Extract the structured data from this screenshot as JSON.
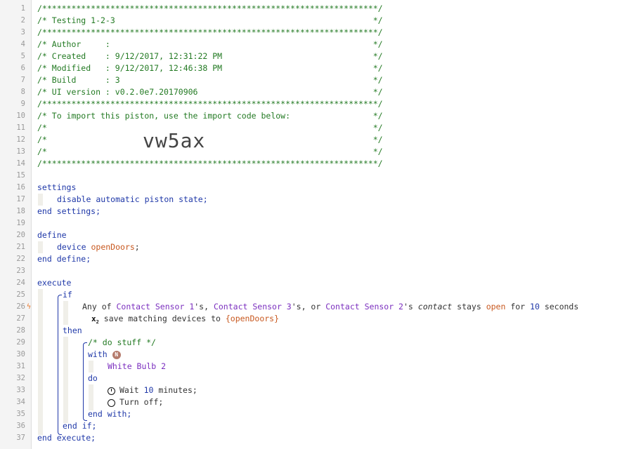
{
  "editor": {
    "header_lines": [
      "/*********************************************************************/",
      "/* Testing 1-2-3                                                     */",
      "/*********************************************************************/",
      "/* Author     :                                                      */",
      "/* Created    : 9/12/2017, 12:31:22 PM                               */",
      "/* Modified   : 9/12/2017, 12:46:38 PM                               */",
      "/* Build      : 3                                                    */",
      "/* UI version : v0.2.0e7.20170906                                    */",
      "/*********************************************************************/",
      "/* To import this piston, use the import code below:                 */",
      "/*                                                                   */",
      "/*                                                                   */",
      "/*                                                                   */",
      "/*********************************************************************/"
    ],
    "import_code": "vw5ax",
    "settings": {
      "open": "settings",
      "body": "disable automatic piston state;",
      "close": "end settings;"
    },
    "define": {
      "open": "define",
      "type": "device",
      "var": "openDoors",
      "semi": ";",
      "close": "end define;"
    },
    "execute": {
      "open": "execute",
      "if": "if",
      "cond_prefix": "Any of ",
      "device1": "Contact Sensor 1",
      "sep1": "'s, ",
      "device2": "Contact Sensor 3",
      "sep2": "'s, or ",
      "device3": "Contact Sensor 2",
      "sep3": "'s ",
      "attribute": "contact",
      "stays": " stays ",
      "state": "open",
      "for": " for ",
      "duration": "10",
      "unit": " seconds",
      "save_text": " save matching devices to ",
      "save_var": "{openDoors}",
      "then": "then",
      "comment": "/* do stuff */",
      "with": "with",
      "n_badge": "N",
      "target": "White Bulb 2",
      "do": "do",
      "wait_prefix": "Wait ",
      "wait_value": "10",
      "wait_suffix": " minutes;",
      "turn_off": "Turn off;",
      "end_with": "end with;",
      "end_if": "end if;",
      "close": "end execute;"
    },
    "line_numbers": [
      "1",
      "2",
      "3",
      "4",
      "5",
      "6",
      "7",
      "8",
      "9",
      "10",
      "11",
      "12",
      "13",
      "14",
      "15",
      "16",
      "17",
      "18",
      "19",
      "20",
      "21",
      "22",
      "23",
      "24",
      "25",
      "26",
      "27",
      "28",
      "29",
      "30",
      "31",
      "32",
      "33",
      "34",
      "35",
      "36",
      "37"
    ]
  },
  "colors": {
    "comment": "#237a23",
    "keyword": "#1f38a8",
    "variable": "#c8581f",
    "device": "#7b2fbf",
    "gutter_bg": "#f4f4f4"
  },
  "icons": {
    "trigger": "lightning-bolt-icon",
    "wait": "clock-icon",
    "off": "circle-icon",
    "save": "x2-variable-icon"
  }
}
